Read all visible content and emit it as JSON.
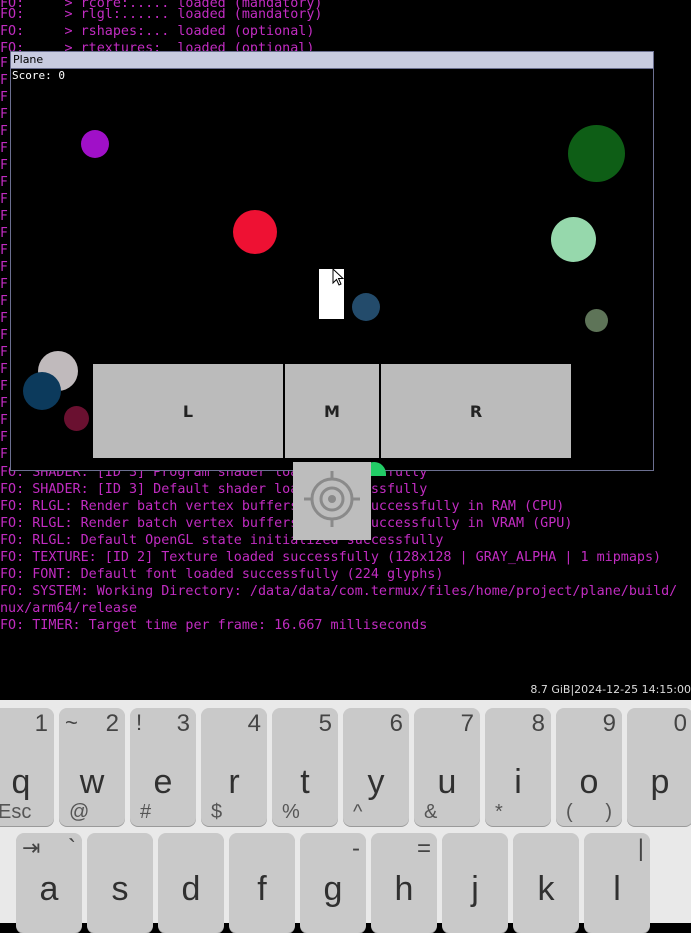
{
  "terminal": {
    "top_lines": [
      "FO:     > rcore:..... loaded (mandatory)",
      "FO:     > rlgl:...... loaded (mandatory)",
      "FO:     > rshapes:... loaded (optional)",
      "FO:     > rtextures:  loaded (optional)"
    ],
    "strip_char": "F",
    "bottom_lines": [
      "FO: SHADER: [ID 3] Program shader loaded successfully",
      "FO: SHADER: [ID 3] Default shader loaded successfully",
      "FO: RLGL: Render batch vertex buffers loaded successfully in RAM (CPU)",
      "FO: RLGL: Render batch vertex buffers loaded successfully in VRAM (GPU)",
      "FO: RLGL: Default OpenGL state initialized successfully",
      "FO: TEXTURE: [ID 2] Texture loaded successfully (128x128 | GRAY_ALPHA | 1 mipmaps)",
      "FO: FONT: Default font loaded successfully (224 glyphs)",
      "FO: SYSTEM: Working Directory: /data/data/com.termux/files/home/project/plane/build/",
      "nux/arm64/release",
      "FO: TIMER: Target time per frame: 16.667 milliseconds"
    ]
  },
  "game": {
    "title": "Plane",
    "score": "Score: 0",
    "balls": [
      {
        "color": "#a010c8"
      },
      {
        "color": "#ee1133"
      },
      {
        "color": "#0e5e16"
      },
      {
        "color": "#96d8ac"
      },
      {
        "color": "#234b6b"
      },
      {
        "color": "#5e7458"
      },
      {
        "color": "#c0babc"
      },
      {
        "color": "#0c3a5c"
      },
      {
        "color": "#6a1030"
      },
      {
        "color": "#22cc66"
      }
    ],
    "buttons": {
      "left": "L",
      "middle": "M",
      "right": "R"
    }
  },
  "status": {
    "text": "8.7 GiB|2024-12-25 14:15:00"
  },
  "keyboard": {
    "row1": [
      {
        "main": "q",
        "num": "1",
        "sym": "",
        "sub": "Esc",
        "sub2": ""
      },
      {
        "main": "w",
        "num": "2",
        "sym": "~",
        "sub": "@",
        "sub2": ""
      },
      {
        "main": "e",
        "num": "3",
        "sym": "!",
        "sub": "#",
        "sub2": ""
      },
      {
        "main": "r",
        "num": "4",
        "sym": "",
        "sub": "$",
        "sub2": ""
      },
      {
        "main": "t",
        "num": "5",
        "sym": "",
        "sub": "%",
        "sub2": ""
      },
      {
        "main": "y",
        "num": "6",
        "sym": "",
        "sub": "^",
        "sub2": ""
      },
      {
        "main": "u",
        "num": "7",
        "sym": "",
        "sub": "&",
        "sub2": ""
      },
      {
        "main": "i",
        "num": "8",
        "sym": "",
        "sub": "*",
        "sub2": ""
      },
      {
        "main": "o",
        "num": "9",
        "sym": "",
        "sub": "(",
        "sub2": ")"
      },
      {
        "main": "p",
        "num": "0",
        "sym": "",
        "sub": "",
        "sub2": ""
      }
    ],
    "row2": [
      {
        "main": "a",
        "num": "`",
        "sym": "⇥",
        "sub": "",
        "sub2": ""
      },
      {
        "main": "s",
        "num": "",
        "sym": "",
        "sub": "",
        "sub2": ""
      },
      {
        "main": "d",
        "num": "",
        "sym": "",
        "sub": "",
        "sub2": ""
      },
      {
        "main": "f",
        "num": "",
        "sym": "",
        "sub": "",
        "sub2": ""
      },
      {
        "main": "g",
        "num": "-",
        "sym": "",
        "sub": "",
        "sub2": ""
      },
      {
        "main": "h",
        "num": "=",
        "sym": "",
        "sub": "",
        "sub2": ""
      },
      {
        "main": "j",
        "num": "",
        "sym": "",
        "sub": "",
        "sub2": ""
      },
      {
        "main": "k",
        "num": "",
        "sym": "",
        "sub": "",
        "sub2": ""
      },
      {
        "main": "l",
        "num": "|",
        "sym": "",
        "sub": "",
        "sub2": ""
      }
    ]
  }
}
